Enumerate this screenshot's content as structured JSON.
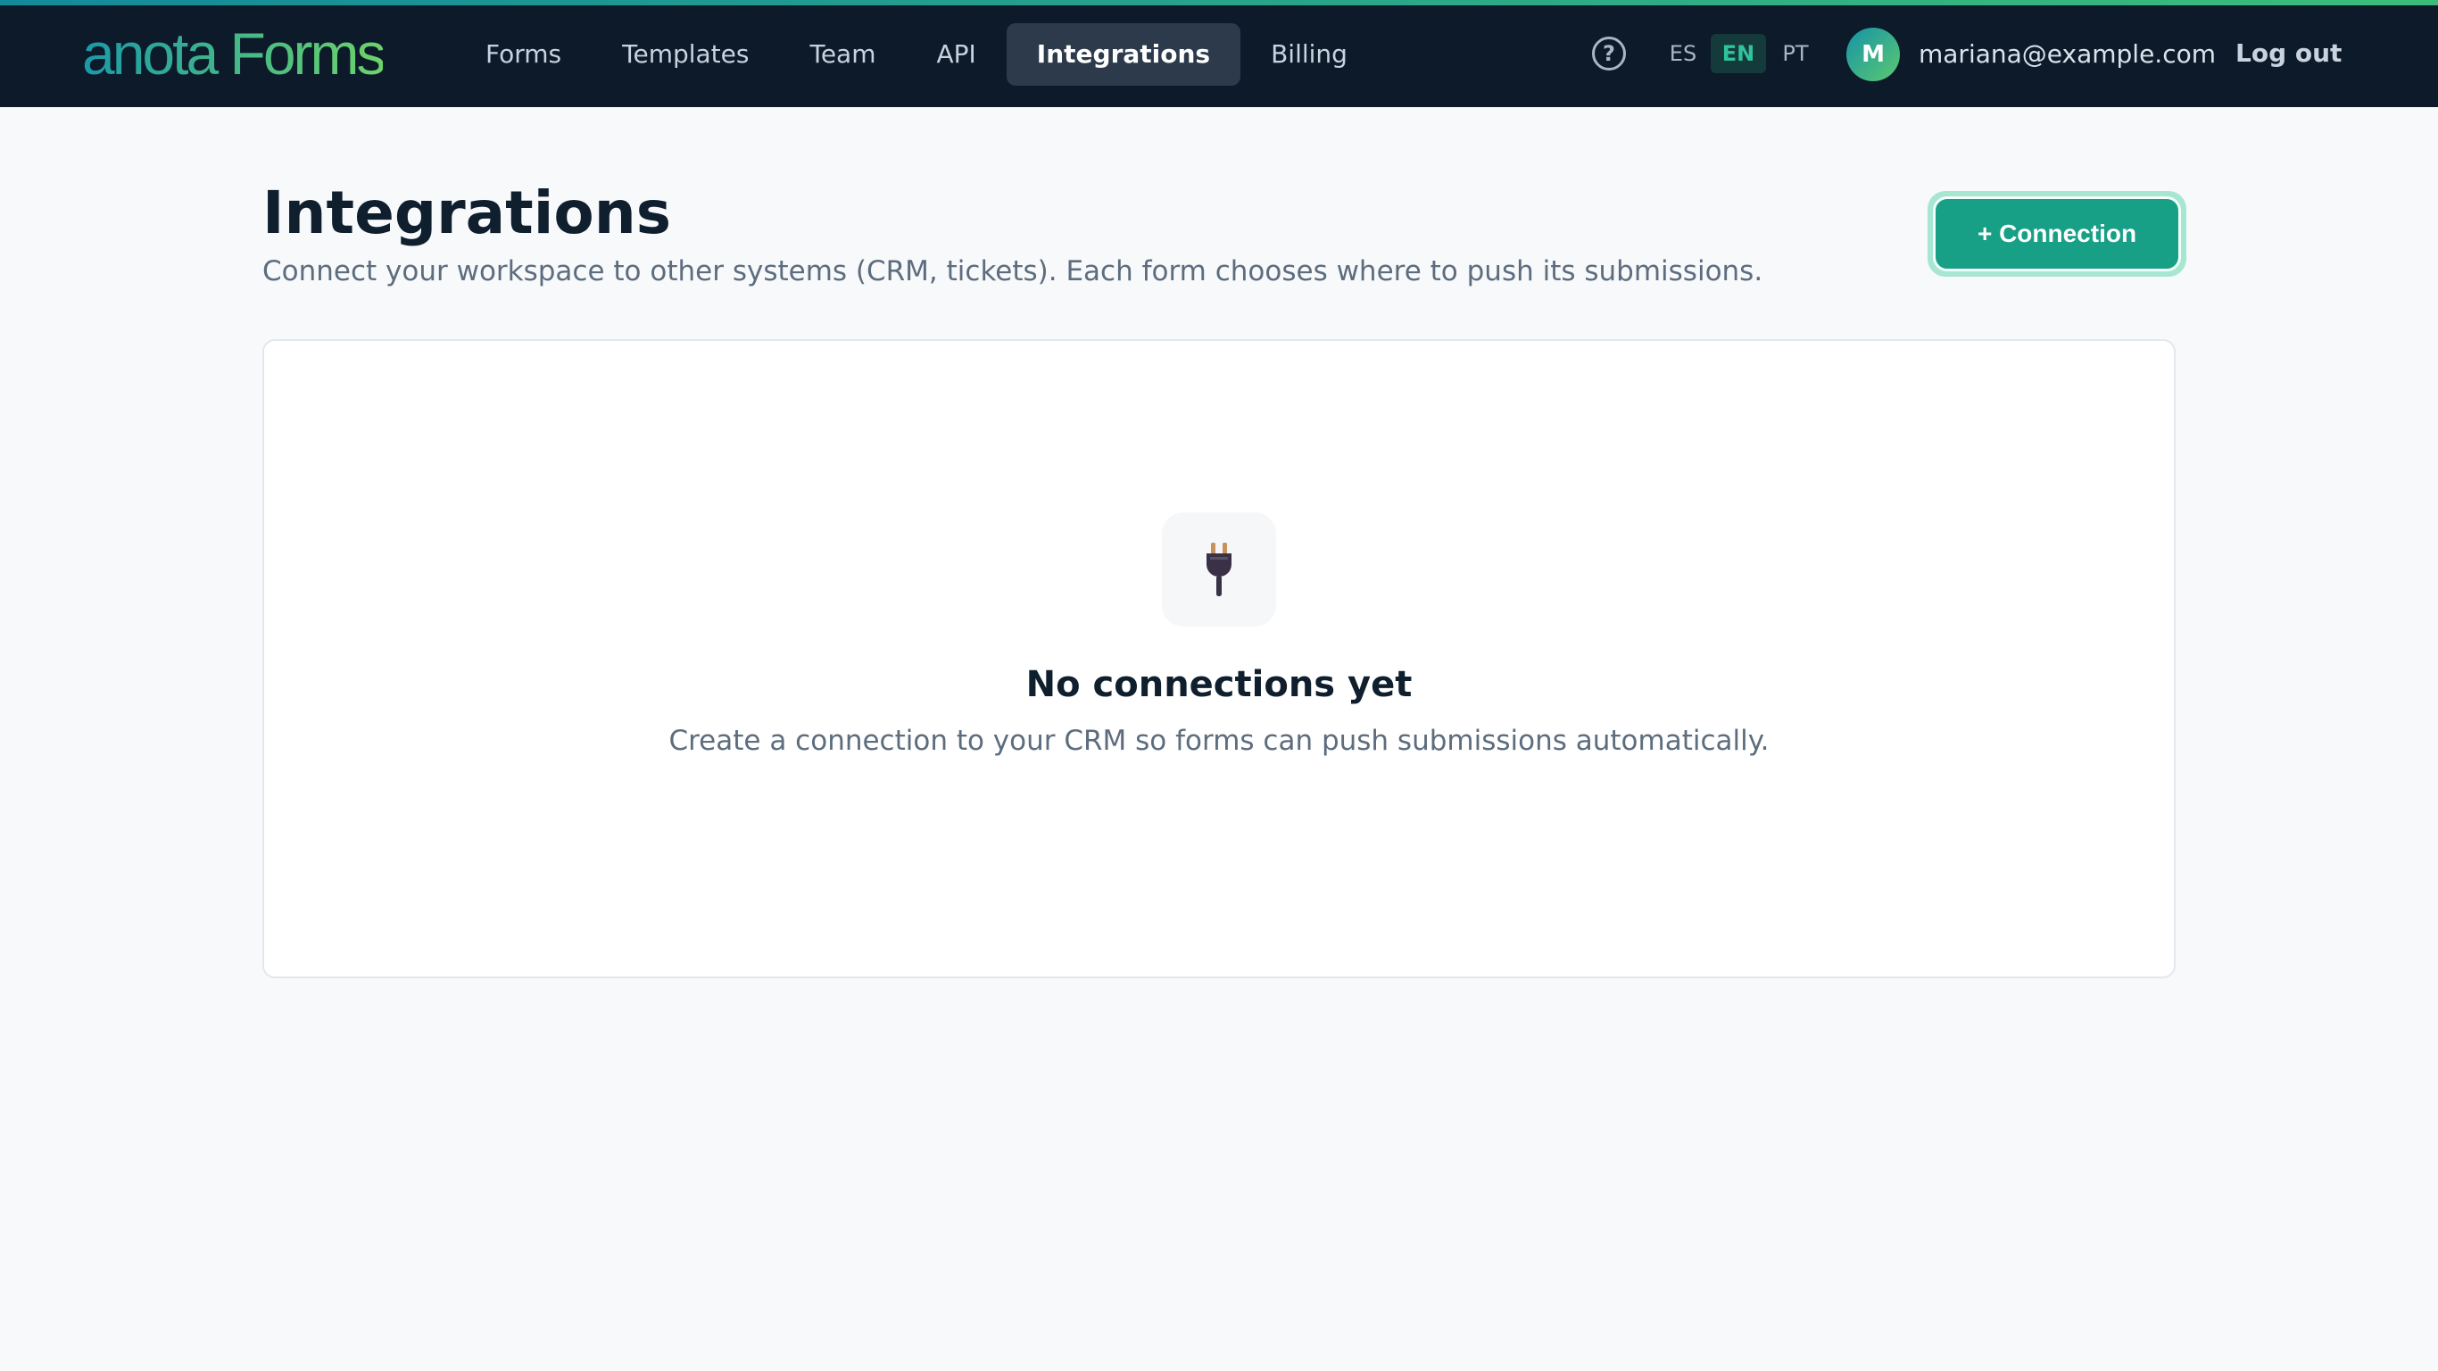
{
  "header": {
    "logo": "anota Forms",
    "nav": [
      {
        "label": "Forms",
        "active": false
      },
      {
        "label": "Templates",
        "active": false
      },
      {
        "label": "Team",
        "active": false
      },
      {
        "label": "API",
        "active": false
      },
      {
        "label": "Integrations",
        "active": true
      },
      {
        "label": "Billing",
        "active": false
      }
    ],
    "help_icon": "question-circle-icon",
    "languages": [
      {
        "code": "ES",
        "active": false
      },
      {
        "code": "EN",
        "active": true
      },
      {
        "code": "PT",
        "active": false
      }
    ],
    "user": {
      "initial": "M",
      "email": "mariana@example.com"
    },
    "logout_label": "Log out"
  },
  "main": {
    "title": "Integrations",
    "subtitle": "Connect your workspace to other systems (CRM, tickets). Each form chooses where to push its submissions.",
    "add_button_label": "+ Connection",
    "empty_state": {
      "icon": "plug-icon",
      "title": "No connections yet",
      "description": "Create a connection to your CRM so forms can push submissions automatically."
    }
  },
  "colors": {
    "header_bg": "#0c1a2a",
    "accent": "#17a086",
    "page_bg": "#f7f9fb"
  }
}
